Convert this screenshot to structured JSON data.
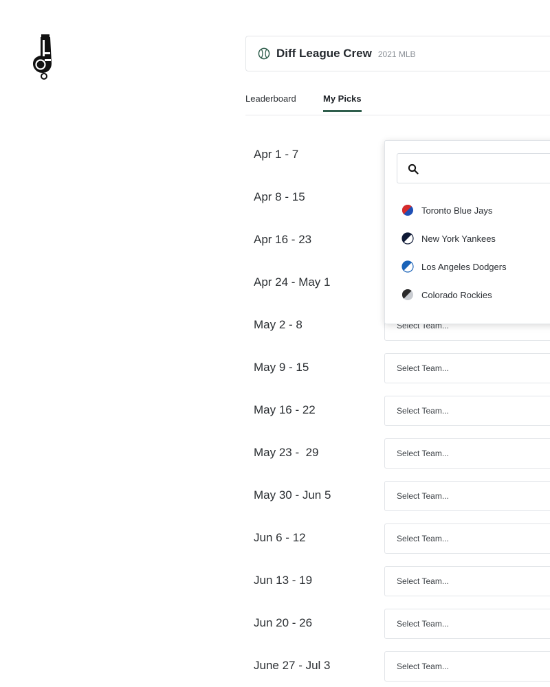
{
  "league": {
    "name": "Diff League Crew",
    "season": "2021 MLB"
  },
  "tabs": [
    {
      "label": "Leaderboard",
      "active": false
    },
    {
      "label": "My Picks",
      "active": true
    }
  ],
  "dropdown": {
    "search_value": "",
    "teams": [
      {
        "name": "Toronto Blue Jays",
        "color_a": "#d62b2b",
        "color_b": "#1f4fb5"
      },
      {
        "name": "New York Yankees",
        "color_a": "#0f1a36",
        "color_b": "#ffffff"
      },
      {
        "name": "Los Angeles Dodgers",
        "color_a": "#1a63b8",
        "color_b": "#ffffff"
      },
      {
        "name": "Colorado Rockies",
        "color_a": "#2a2a2a",
        "color_b": "#c9ccd1"
      }
    ]
  },
  "weeks": [
    {
      "label": "Apr 1 - 7",
      "select": ""
    },
    {
      "label": "Apr 8 - 15",
      "select": ""
    },
    {
      "label": "Apr 16 - 23",
      "select": ""
    },
    {
      "label": "Apr 24 - May 1",
      "select": ""
    },
    {
      "label": "May 2 - 8",
      "select": "Select Team..."
    },
    {
      "label": "May 9 - 15",
      "select": "Select Team..."
    },
    {
      "label": "May 16 - 22",
      "select": "Select Team..."
    },
    {
      "label": "May 23 -  29",
      "select": "Select Team..."
    },
    {
      "label": "May 30 - Jun 5",
      "select": "Select Team..."
    },
    {
      "label": "Jun 6 - 12",
      "select": "Select Team..."
    },
    {
      "label": "Jun 13 - 19",
      "select": "Select Team..."
    },
    {
      "label": "Jun 20 - 26",
      "select": "Select Team..."
    },
    {
      "label": "June 27 - Jul 3",
      "select": "Select Team..."
    }
  ],
  "colors": {
    "accent": "#2f5e4c",
    "border": "#e1e4e8"
  }
}
